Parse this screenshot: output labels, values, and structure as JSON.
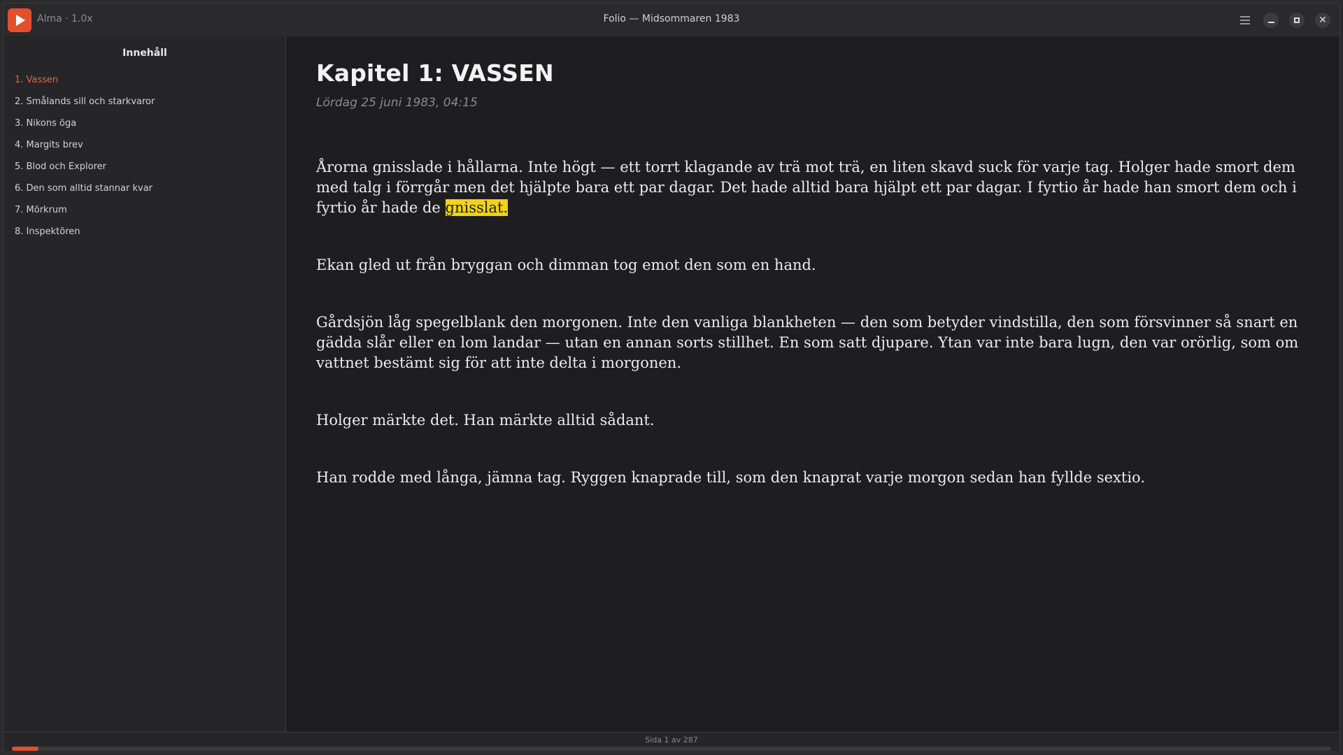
{
  "titlebar": {
    "player_label": "Alma · 1.0x",
    "window_title": "Folio — Midsommaren 1983",
    "icons": [
      "play-icon",
      "menu-icon",
      "minimize-icon",
      "maximize-icon",
      "close-icon"
    ]
  },
  "sidebar": {
    "title": "Innehåll",
    "items": [
      {
        "label": "1. Vassen",
        "active": true
      },
      {
        "label": "2. Smålands sill och starkvaror",
        "active": false
      },
      {
        "label": "3. Nikons öga",
        "active": false
      },
      {
        "label": "4. Margits brev",
        "active": false
      },
      {
        "label": "5. Blod och Explorer",
        "active": false
      },
      {
        "label": "6. Den som alltid stannar kvar",
        "active": false
      },
      {
        "label": "7. Mörkrum",
        "active": false
      },
      {
        "label": "8. Inspektören",
        "active": false
      }
    ]
  },
  "chapter": {
    "title": "Kapitel 1: VASSEN",
    "date": "Lördag 25 juni 1983, 04:15",
    "paragraphs": [
      {
        "text": "Årorna gnisslade i hållarna. Inte högt — ett torrt klagande av trä mot trä, en liten skavd suck för varje tag. Holger hade smort dem med talg i förrgår men det hjälpte bara ett par dagar. Det hade alltid bara hjälpt ett par dagar. I fyrtio år hade han smort dem och i fyrtio år hade de ",
        "highlight": "gnisslat."
      },
      {
        "text": "Ekan gled ut från bryggan och dimman tog emot den som en hand.",
        "highlight": ""
      },
      {
        "text": "Gårdsjön låg spegelblank den morgonen. Inte den vanliga blankheten — den som betyder vindstilla, den som försvinner så snart en gädda slår eller en lom landar — utan en annan sorts stillhet. En som satt djupare. Ytan var inte bara lugn, den var orörlig, som om vattnet bestämt sig för att inte delta i morgonen.",
        "highlight": ""
      },
      {
        "text": "Holger märkte det. Han märkte alltid sådant.",
        "highlight": ""
      },
      {
        "text": "Han rodde med långa, jämna tag. Ryggen knaprade till, som den knaprat varje morgon sedan han fyllde sextio.",
        "highlight": ""
      }
    ]
  },
  "status": {
    "page_info": "Sida 1 av 287",
    "current_page": 1,
    "total_pages": 287,
    "progress_fraction": 0.02
  },
  "colors": {
    "accent": "#e2502b",
    "highlight": "#f2d21a",
    "active_toc": "#e2653f"
  }
}
